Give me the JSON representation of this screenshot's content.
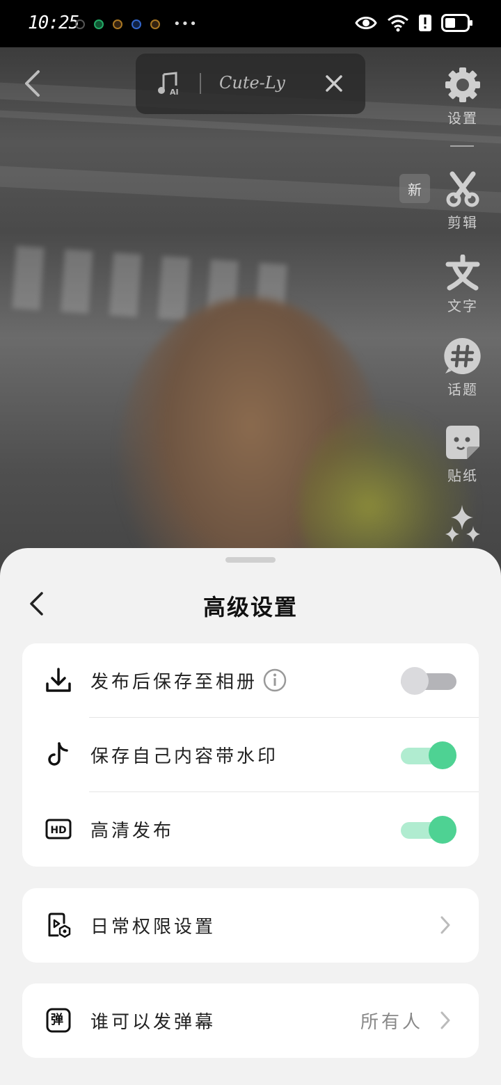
{
  "status_bar": {
    "time": "10:25",
    "overflow": "•••"
  },
  "camera": {
    "song_name": "Cute-Ly"
  },
  "toolbar": {
    "items": [
      {
        "label": "设置",
        "icon": "gear-icon"
      },
      {
        "label": "剪辑",
        "icon": "scissors-icon"
      },
      {
        "label": "文字",
        "icon": "text-icon"
      },
      {
        "label": "话题",
        "icon": "hashtag-icon"
      },
      {
        "label": "贴纸",
        "icon": "sticker-icon"
      },
      {
        "label": "",
        "icon": "sparkles-icon"
      }
    ],
    "new_badge": "新"
  },
  "sheet": {
    "title": "高级设置",
    "toggle_card": [
      {
        "label": "发布后保存至相册",
        "icon": "download-icon",
        "toggle_on": false,
        "has_info": true
      },
      {
        "label": "保存自己内容带水印",
        "icon": "tiktok-icon",
        "toggle_on": true
      },
      {
        "label": "高清发布",
        "icon": "hd-icon",
        "toggle_on": true
      }
    ],
    "permissions": {
      "label": "日常权限设置",
      "icon": "video-settings-icon"
    },
    "danmaku": {
      "label": "谁可以发弹幕",
      "value": "所有人",
      "icon": "danmaku-icon",
      "icon_text": "弹"
    }
  },
  "colors": {
    "toggle_on": "#4ed293",
    "toggle_on_track": "#b0ecd0",
    "toggle_off_track": "#b4b4b8",
    "sheet_bg": "#f2f2f2"
  }
}
